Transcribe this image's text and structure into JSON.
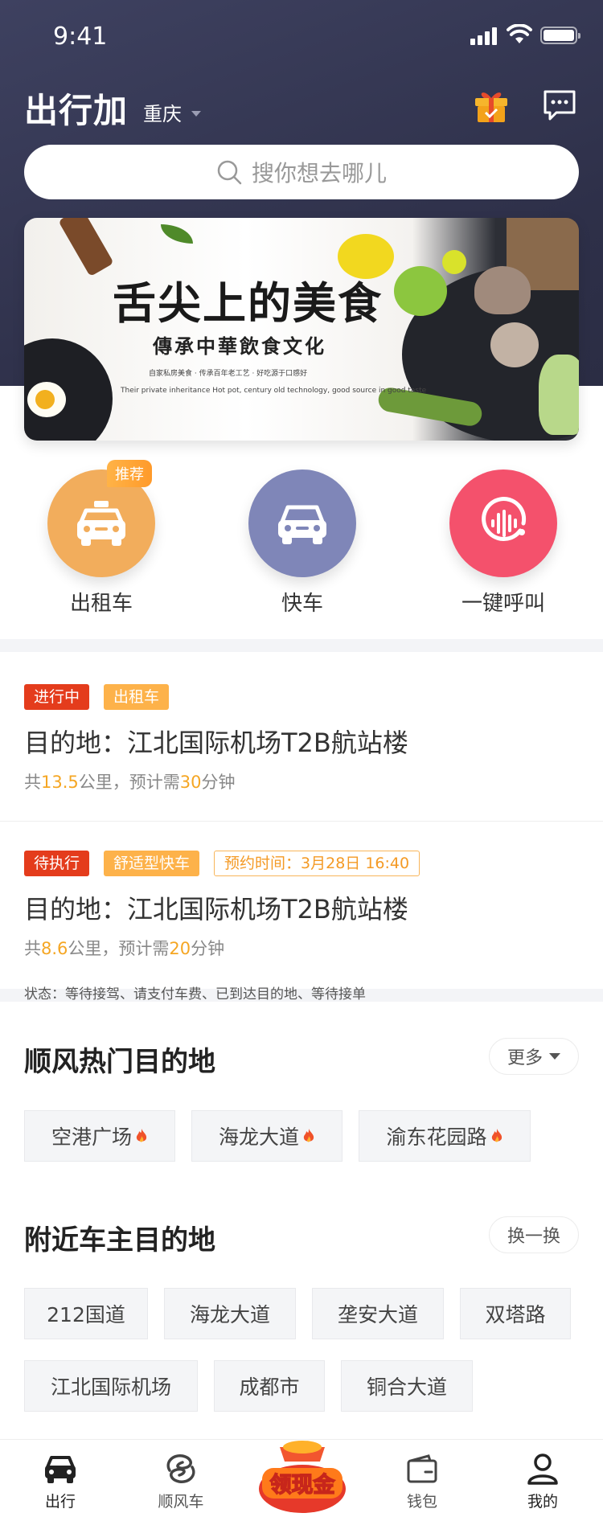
{
  "status_bar": {
    "time": "9:41"
  },
  "header": {
    "title": "出行加",
    "city": "重庆"
  },
  "search": {
    "placeholder": "搜你想去哪儿"
  },
  "banner": {
    "title": "舌尖上的美食",
    "subtitle": "傳承中華飲食文化",
    "line1": "自家私房美食 · 传承百年老工艺 · 好吃源于口感好",
    "line2": "Their private inheritance Hot pot, century old technology, good source in good taste"
  },
  "services": [
    {
      "label": "出租车",
      "badge": "推荐",
      "color": "#f2ad5c",
      "icon": "taxi-icon"
    },
    {
      "label": "快车",
      "color": "#7f86b8",
      "icon": "car-icon"
    },
    {
      "label": "一键呼叫",
      "color": "#f4516c",
      "icon": "voice-call-icon"
    }
  ],
  "orders": [
    {
      "status": "进行中",
      "type": "出租车",
      "destination": "目的地：江北国际机场T2B航站楼",
      "prefix": "共",
      "distance": "13.5",
      "mid": "公里，预计需",
      "minutes": "30",
      "suffix": "分钟"
    },
    {
      "status": "待执行",
      "type": "舒适型快车",
      "booking": "预约时间：3月28日 16:40",
      "destination": "目的地：江北国际机场T2B航站楼",
      "prefix": "共",
      "distance": "8.6",
      "mid": "公里，预计需",
      "minutes": "20",
      "suffix": "分钟"
    }
  ],
  "status_note": "状态：等待接驾、请支付车费、已到达目的地、等待接单",
  "hot_destinations": {
    "title": "顺风热门目的地",
    "more_label": "更多",
    "items": [
      "空港广场",
      "海龙大道",
      "渝东花园路"
    ]
  },
  "nearby": {
    "title": "附近车主目的地",
    "refresh_label": "换一换",
    "items": [
      "212国道",
      "海龙大道",
      "垄安大道",
      "双塔路",
      "江北国际机场",
      "成都市",
      "铜合大道"
    ]
  },
  "tabbar": {
    "items": [
      "出行",
      "顺风车",
      "钱包",
      "我的"
    ],
    "center_label": "领现金"
  }
}
